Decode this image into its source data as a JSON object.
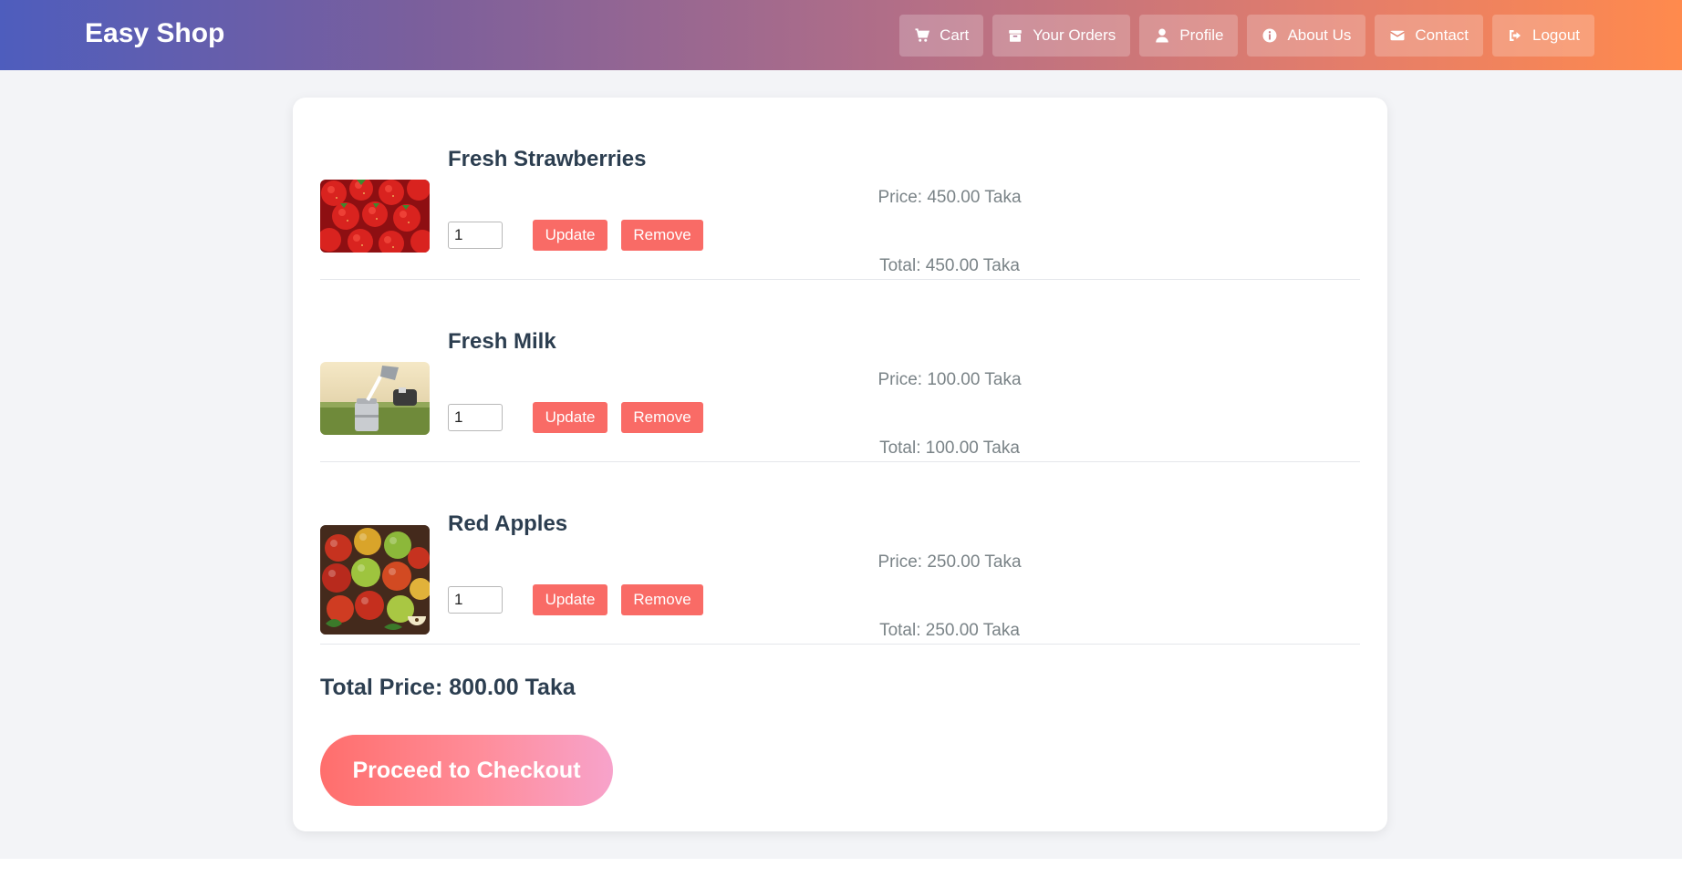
{
  "brand": "Easy Shop",
  "nav": {
    "items": [
      {
        "label": "Cart",
        "icon": "cart-icon"
      },
      {
        "label": "Your Orders",
        "icon": "box-icon"
      },
      {
        "label": "Profile",
        "icon": "user-icon"
      },
      {
        "label": "About Us",
        "icon": "info-icon"
      },
      {
        "label": "Contact",
        "icon": "envelope-icon"
      },
      {
        "label": "Logout",
        "icon": "logout-icon"
      }
    ]
  },
  "cart": {
    "items": [
      {
        "name": "Fresh Strawberries",
        "quantity": "1",
        "price": "Price: 450.00 Taka",
        "total": "Total: 450.00 Taka",
        "image": "strawberries-image"
      },
      {
        "name": "Fresh Milk",
        "quantity": "1",
        "price": "Price: 100.00 Taka",
        "total": "Total: 100.00 Taka",
        "image": "milk-image"
      },
      {
        "name": "Red Apples",
        "quantity": "1",
        "price": "Price: 250.00 Taka",
        "total": "Total: 250.00 Taka",
        "image": "apples-image"
      }
    ],
    "update_label": "Update",
    "remove_label": "Remove",
    "total_price": "Total Price: 800.00 Taka",
    "checkout_label": "Proceed to Checkout"
  },
  "colors": {
    "button": "#f96b66",
    "heading": "#2c3e50",
    "muted_text": "#7a8387"
  }
}
